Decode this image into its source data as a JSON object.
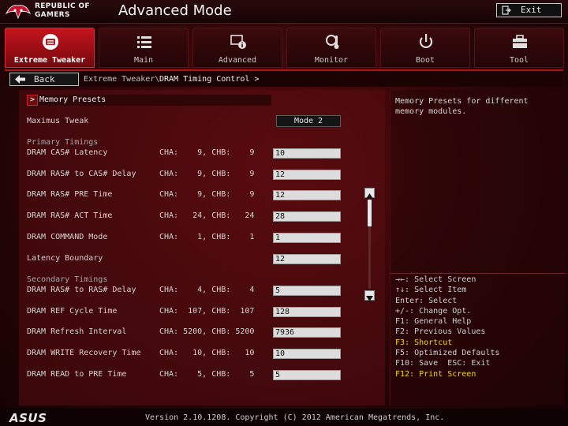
{
  "header": {
    "brand_line1": "REPUBLIC OF",
    "brand_line2": "GAMERS",
    "title": "Advanced Mode",
    "exit_label": "Exit"
  },
  "tabs": [
    {
      "label": "Extreme Tweaker",
      "icon": "extreme-tweaker-icon",
      "active": true
    },
    {
      "label": "Main",
      "icon": "list-icon",
      "active": false
    },
    {
      "label": "Advanced",
      "icon": "advanced-info-icon",
      "active": false
    },
    {
      "label": "Monitor",
      "icon": "thermometer-icon",
      "active": false
    },
    {
      "label": "Boot",
      "icon": "power-icon",
      "active": false
    },
    {
      "label": "Tool",
      "icon": "toolbox-icon",
      "active": false
    }
  ],
  "breadcrumb": {
    "back_label": "Back",
    "parent": "Extreme Tweaker\\",
    "current": "DRAM Timing Control >"
  },
  "main": {
    "presets_label": "Memory Presets",
    "maximus_tweak": {
      "label": "Maximus Tweak",
      "value": "Mode 2"
    },
    "primary_title": "Primary Timings",
    "primary": [
      {
        "label": "DRAM CAS# Latency",
        "cha": "CHA:    9, CHB:    9",
        "value": "10"
      },
      {
        "label": "DRAM RAS# to CAS# Delay",
        "cha": "CHA:    9, CHB:    9",
        "value": "12"
      },
      {
        "label": "DRAM RAS# PRE Time",
        "cha": "CHA:    9, CHB:    9",
        "value": "12"
      },
      {
        "label": "DRAM RAS# ACT Time",
        "cha": "CHA:   24, CHB:   24",
        "value": "28"
      },
      {
        "label": "DRAM COMMAND Mode",
        "cha": "CHA:    1, CHB:    1",
        "value": "1"
      },
      {
        "label": "Latency Boundary",
        "cha": "",
        "value": "12"
      }
    ],
    "secondary_title": "Secondary Timings",
    "secondary": [
      {
        "label": "DRAM RAS# to RAS# Delay",
        "cha": "CHA:    4, CHB:    4",
        "value": "5"
      },
      {
        "label": "DRAM REF Cycle Time",
        "cha": "CHA:  107, CHB:  107",
        "value": "128"
      },
      {
        "label": "DRAM Refresh Interval",
        "cha": "CHA: 5200, CHB: 5200",
        "value": "7936"
      },
      {
        "label": "DRAM WRITE Recovery Time",
        "cha": "CHA:   10, CHB:   10",
        "value": "10"
      },
      {
        "label": "DRAM READ to PRE Time",
        "cha": "CHA:    5, CHB:    5",
        "value": "5"
      }
    ]
  },
  "help": {
    "description": "Memory Presets for different memory modules.",
    "keys": [
      {
        "text": "→←: Select Screen",
        "highlight": false
      },
      {
        "text": "↑↓: Select Item",
        "highlight": false
      },
      {
        "text": "Enter: Select",
        "highlight": false
      },
      {
        "text": "+/-: Change Opt.",
        "highlight": false
      },
      {
        "text": "F1: General Help",
        "highlight": false
      },
      {
        "text": "F2: Previous Values",
        "highlight": false
      },
      {
        "text": "F3: Shortcut",
        "highlight": true
      },
      {
        "text": "F5: Optimized Defaults",
        "highlight": false
      },
      {
        "text": "F10: Save  ESC: Exit",
        "highlight": false
      },
      {
        "text": "F12: Print Screen",
        "highlight": true
      }
    ]
  },
  "footer": {
    "logo": "ASUS",
    "version": "Version 2.10.1208. Copyright (C) 2012 American Megatrends, Inc."
  },
  "colors": {
    "accent_red": "#c4141d",
    "highlight_yellow": "#f6d800"
  }
}
